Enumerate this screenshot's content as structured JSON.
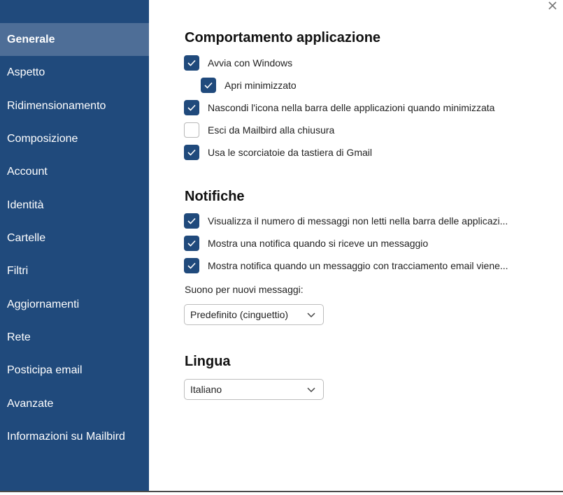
{
  "sidebar": {
    "items": [
      {
        "label": "Generale",
        "active": true
      },
      {
        "label": "Aspetto"
      },
      {
        "label": "Ridimensionamento"
      },
      {
        "label": "Composizione"
      },
      {
        "label": "Account"
      },
      {
        "label": "Identità"
      },
      {
        "label": "Cartelle"
      },
      {
        "label": "Filtri"
      },
      {
        "label": "Aggiornamenti"
      },
      {
        "label": "Rete"
      },
      {
        "label": "Posticipa email"
      },
      {
        "label": "Avanzate"
      },
      {
        "label": "Informazioni su Mailbird"
      }
    ]
  },
  "window": {
    "close_icon": "close-icon"
  },
  "behavior": {
    "title": "Comportamento applicazione",
    "options": [
      {
        "label": "Avvia con Windows",
        "checked": true
      },
      {
        "label": "Apri minimizzato",
        "checked": true
      },
      {
        "label": "Nascondi l'icona nella barra delle applicazioni quando minimizzata",
        "checked": true
      },
      {
        "label": "Esci da Mailbird alla chiusura",
        "checked": false
      },
      {
        "label": "Usa le scorciatoie da tastiera di Gmail",
        "checked": true
      }
    ]
  },
  "notifications": {
    "title": "Notifiche",
    "options": [
      {
        "label": "Visualizza il numero di messaggi non letti nella barra delle applicazi...",
        "checked": true
      },
      {
        "label": "Mostra una notifica quando si riceve un messaggio",
        "checked": true
      },
      {
        "label": "Mostra notifica quando un messaggio con tracciamento email viene...",
        "checked": true
      }
    ],
    "sound_label": "Suono per nuovi messaggi:",
    "sound_value": "Predefinito (cinguettio)"
  },
  "language": {
    "title": "Lingua",
    "value": "Italiano"
  },
  "colors": {
    "sidebar": "#204a7c",
    "sidebar_active": "#4e6e97",
    "checkbox": "#204a7c"
  }
}
